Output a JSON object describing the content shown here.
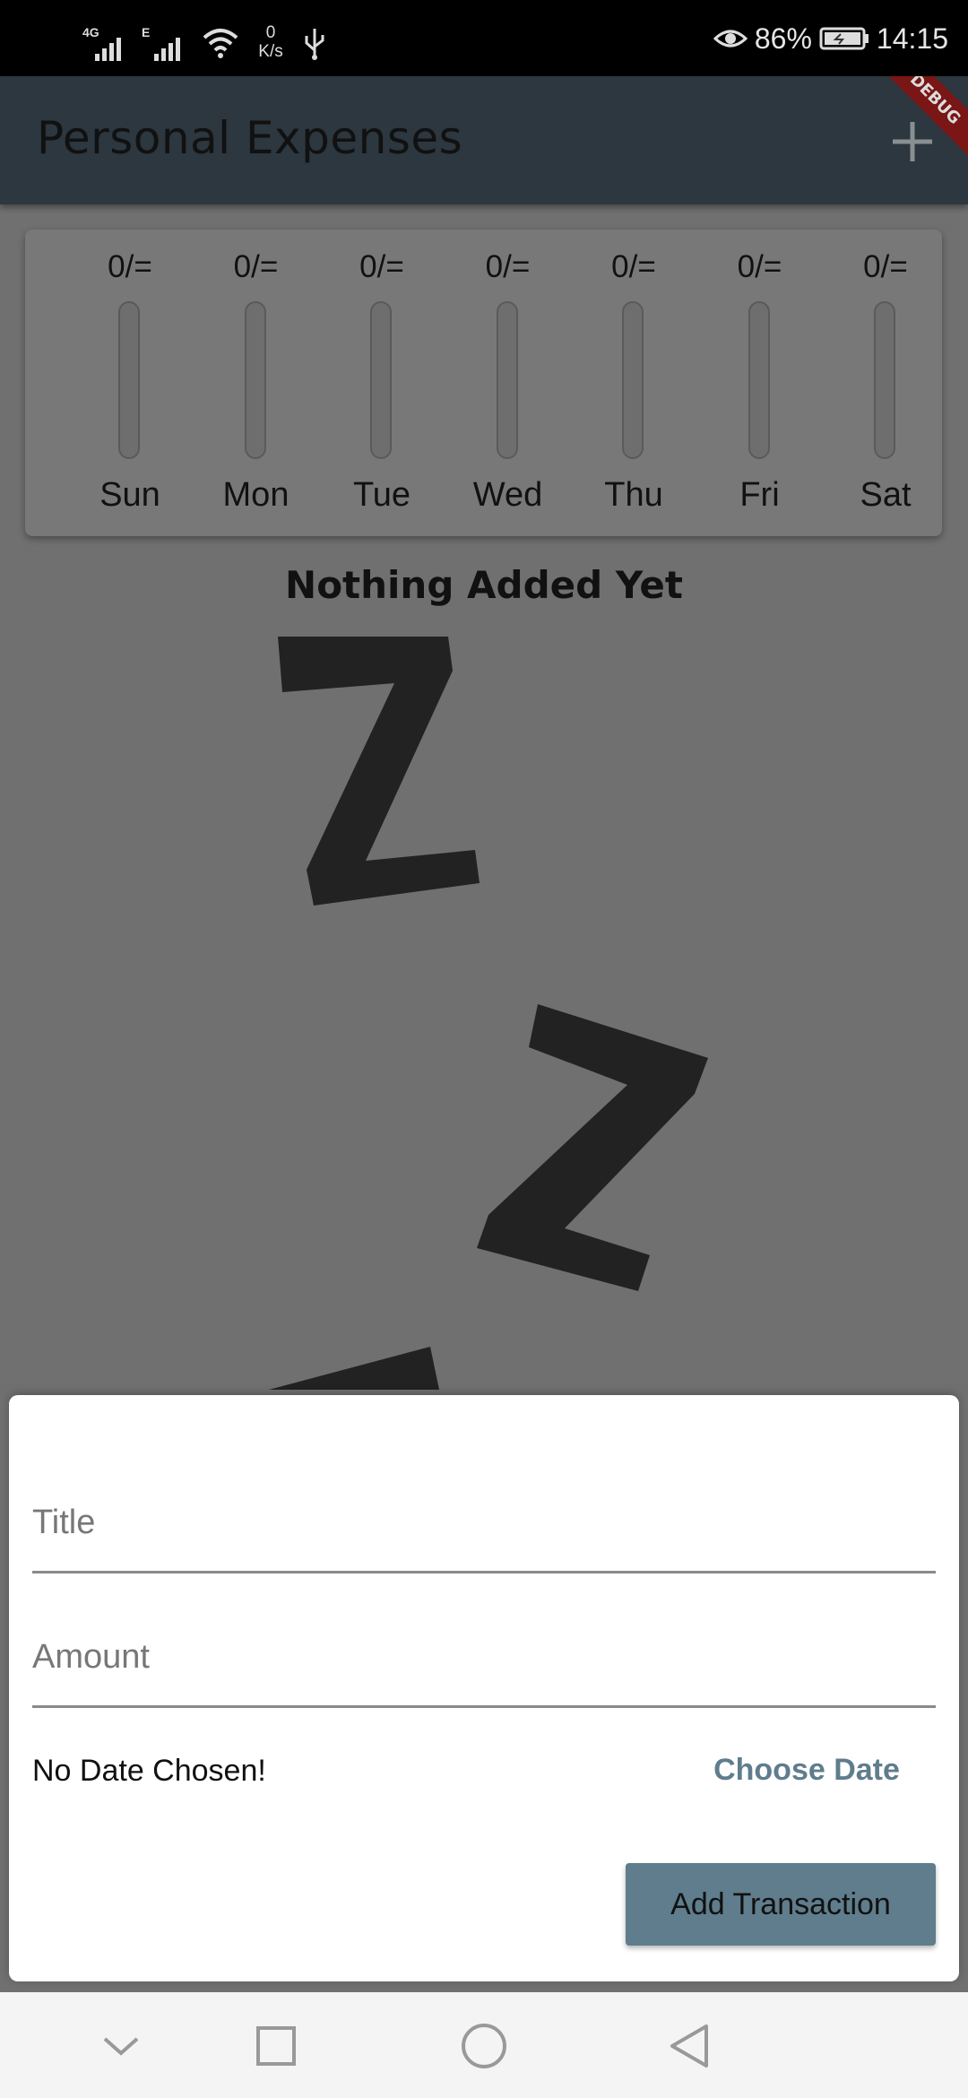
{
  "status_bar": {
    "network1": "4G",
    "network2": "E",
    "speed_value": "0",
    "speed_unit": "K/s",
    "battery": "86%",
    "time": "14:15",
    "icons": [
      "signal-icon",
      "wifi-icon",
      "usb-icon",
      "eye-icon",
      "battery-icon"
    ]
  },
  "app_bar": {
    "title": "Personal Expenses",
    "add_icon": "plus-icon",
    "debug_ribbon": "DEBUG"
  },
  "chart": {
    "days": [
      {
        "amount": "0/=",
        "day": "Sun",
        "fraction": 0
      },
      {
        "amount": "0/=",
        "day": "Mon",
        "fraction": 0
      },
      {
        "amount": "0/=",
        "day": "Tue",
        "fraction": 0
      },
      {
        "amount": "0/=",
        "day": "Wed",
        "fraction": 0
      },
      {
        "amount": "0/=",
        "day": "Thu",
        "fraction": 0
      },
      {
        "amount": "0/=",
        "day": "Fri",
        "fraction": 0
      },
      {
        "amount": "0/=",
        "day": "Sat",
        "fraction": 0
      }
    ]
  },
  "empty_state": {
    "title": "Nothing Added Yet",
    "image": "sleeping-zzz-image"
  },
  "new_transaction": {
    "title_placeholder": "Title",
    "title_value": "",
    "amount_placeholder": "Amount",
    "amount_value": "",
    "date_text": "No Date Chosen!",
    "choose_date_label": "Choose Date",
    "submit_label": "Add Transaction"
  },
  "nav_bar": {
    "items": [
      "chevron-down-icon",
      "recents-square-icon",
      "home-circle-icon",
      "back-triangle-icon"
    ]
  },
  "colors": {
    "app_bar": "#2c373f",
    "accent": "#5f7d8c",
    "scrim": "#707070"
  }
}
